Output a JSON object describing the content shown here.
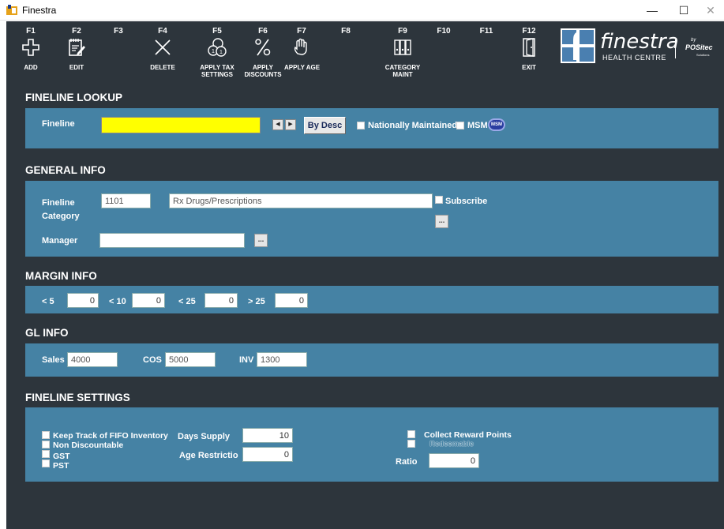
{
  "window": {
    "title": "Finestra",
    "minimize": "—",
    "maximize": "☐",
    "close": "✕"
  },
  "toolbar": {
    "keys": [
      {
        "key": "F1",
        "icon": "plus-icon",
        "label": "ADD"
      },
      {
        "key": "F2",
        "icon": "notepad-edit-icon",
        "label": "EDIT"
      },
      {
        "key": "F3",
        "icon": "",
        "label": ""
      },
      {
        "key": "F4",
        "icon": "x-delete-icon",
        "label": "DELETE"
      },
      {
        "key": "F5",
        "icon": "coins-tax-icon",
        "label": "APPLY TAX\nSETTINGS"
      },
      {
        "key": "F6",
        "icon": "percent-icon",
        "label": "APPLY\nDISCOUNTS"
      },
      {
        "key": "F7",
        "icon": "hand-age-icon",
        "label": "APPLY AGE"
      },
      {
        "key": "F8",
        "icon": "",
        "label": ""
      },
      {
        "key": "F9",
        "icon": "binders-icon",
        "label": "CATEGORY\nMAINT"
      },
      {
        "key": "F10",
        "icon": "",
        "label": ""
      },
      {
        "key": "F11",
        "icon": "",
        "label": ""
      },
      {
        "key": "F12",
        "icon": "door-exit-icon",
        "label": "EXIT"
      }
    ]
  },
  "logo": {
    "brand": "finestra",
    "subtitle": "HEALTH CENTRE",
    "by": "by",
    "partner": "POSitec",
    "partner_sub": "Solutions"
  },
  "lookup": {
    "title": "FINELINE LOOKUP",
    "fineline_label": "Fineline",
    "fineline_value": "",
    "prev": "◀",
    "next": "▶",
    "by_desc": "By Desc",
    "nationally_maintained": "Nationally Maintained",
    "msm": "MSM",
    "msm_badge": "MSM"
  },
  "general": {
    "title": "GENERAL INFO",
    "fineline_label": "Fineline",
    "category_label": "Category",
    "code": "1101",
    "description": "Rx Drugs/Prescriptions",
    "subscribe": "Subscribe",
    "manager_label": "Manager",
    "manager_value": "",
    "ellipsis": "..."
  },
  "margin": {
    "title": "MARGIN INFO",
    "fields": [
      {
        "label": "< 5",
        "value": "0"
      },
      {
        "label": "< 10",
        "value": "0"
      },
      {
        "label": "< 25",
        "value": "0"
      },
      {
        "label": "> 25",
        "value": "0"
      }
    ]
  },
  "gl": {
    "title": "GL INFO",
    "sales_label": "Sales",
    "sales_value": "4000",
    "cos_label": "COS",
    "cos_value": "5000",
    "inv_label": "INV",
    "inv_value": "1300"
  },
  "settings": {
    "title": "FINELINE SETTINGS",
    "keep_fifo": "Keep Track of FIFO Inventory",
    "non_discountable": "Non Discountable",
    "gst": "GST",
    "pst": "PST",
    "days_supply_label": "Days Supply",
    "days_supply_value": "10",
    "age_restriction_label": "Age Restrictio",
    "age_restriction_value": "0",
    "collect_reward_points": "Collect Reward Points",
    "redeemable": "Redeemable",
    "ratio_label": "Ratio",
    "ratio_value": "0"
  },
  "colors": {
    "background": "#2d353c",
    "panel": "#4582a4",
    "highlight": "#ffff00"
  }
}
